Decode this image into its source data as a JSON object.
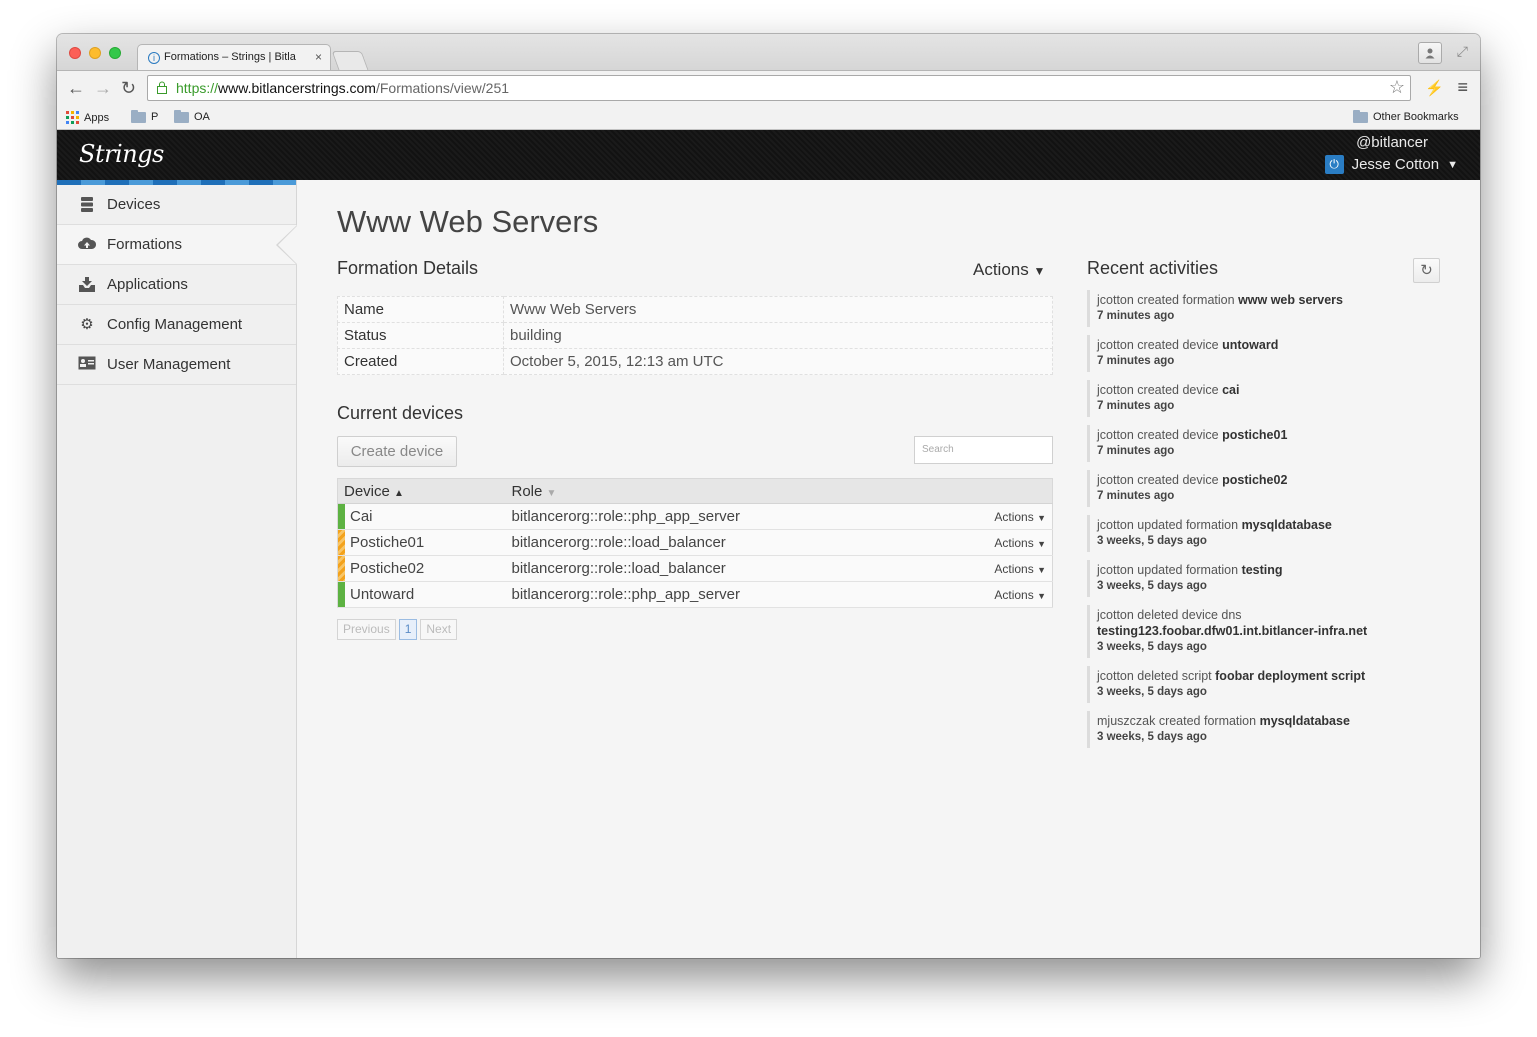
{
  "browser": {
    "tab_title": "Formations – Strings | Bitla",
    "tab_close": "×",
    "url_scheme": "https://",
    "url_host": "www.bitlancerstrings.com",
    "url_path": "/Formations/view/251",
    "bookmarks": {
      "apps": "Apps",
      "folder_p": "P",
      "folder_oa": "OA",
      "other": "Other Bookmarks"
    }
  },
  "header": {
    "logo": "Strings",
    "handle": "@bitlancer",
    "user_name": "Jesse Cotton"
  },
  "sidebar": {
    "items": [
      {
        "label": "Devices",
        "icon": "server-icon"
      },
      {
        "label": "Formations",
        "icon": "cloud-icon"
      },
      {
        "label": "Applications",
        "icon": "inbox-download-icon"
      },
      {
        "label": "Config Management",
        "icon": "gears-icon"
      },
      {
        "label": "User Management",
        "icon": "user-card-icon"
      }
    ],
    "active": "Formations"
  },
  "main": {
    "title": "Www Web Servers",
    "details": {
      "heading": "Formation Details",
      "actions": "Actions",
      "rows": [
        {
          "key": "Name",
          "value": "Www Web Servers"
        },
        {
          "key": "Status",
          "value": "building"
        },
        {
          "key": "Created",
          "value": "October 5, 2015, 12:13 am UTC"
        }
      ]
    },
    "devices": {
      "heading": "Current devices",
      "create_button": "Create device",
      "search_placeholder": "Search",
      "col_device": "Device",
      "col_role": "Role",
      "row_action": "Actions",
      "rows": [
        {
          "name": "Cai",
          "role": "bitlancerorg::role::php_app_server",
          "status": "green"
        },
        {
          "name": "Postiche01",
          "role": "bitlancerorg::role::load_balancer",
          "status": "orange"
        },
        {
          "name": "Postiche02",
          "role": "bitlancerorg::role::load_balancer",
          "status": "orange"
        },
        {
          "name": "Untoward",
          "role": "bitlancerorg::role::php_app_server",
          "status": "green"
        }
      ],
      "pager": {
        "previous": "Previous",
        "current": "1",
        "next": "Next"
      }
    }
  },
  "activities": {
    "heading": "Recent activities",
    "items": [
      {
        "text": "jcotton created formation",
        "object": "www web servers",
        "ago": "7 minutes ago"
      },
      {
        "text": "jcotton created device",
        "object": "untoward",
        "ago": "7 minutes ago"
      },
      {
        "text": "jcotton created device",
        "object": "cai",
        "ago": "7 minutes ago"
      },
      {
        "text": "jcotton created device",
        "object": "postiche01",
        "ago": "7 minutes ago"
      },
      {
        "text": "jcotton created device",
        "object": "postiche02",
        "ago": "7 minutes ago"
      },
      {
        "text": "jcotton updated formation",
        "object": "mysqldatabase",
        "ago": "3 weeks, 5 days ago"
      },
      {
        "text": "jcotton updated formation",
        "object": "testing",
        "ago": "3 weeks, 5 days ago"
      },
      {
        "text": "jcotton deleted device dns",
        "object": "testing123.foobar.dfw01.int.bitlancer-infra.net",
        "ago": "3 weeks, 5 days ago"
      },
      {
        "text": "jcotton deleted script",
        "object": "foobar deployment script",
        "ago": "3 weeks, 5 days ago"
      },
      {
        "text": "mjuszczak created formation",
        "object": "mysqldatabase",
        "ago": "3 weeks, 5 days ago"
      }
    ]
  },
  "colors": {
    "accent": "#2a7dc4",
    "status_green": "#5db242",
    "status_orange": "#f3a21c"
  }
}
